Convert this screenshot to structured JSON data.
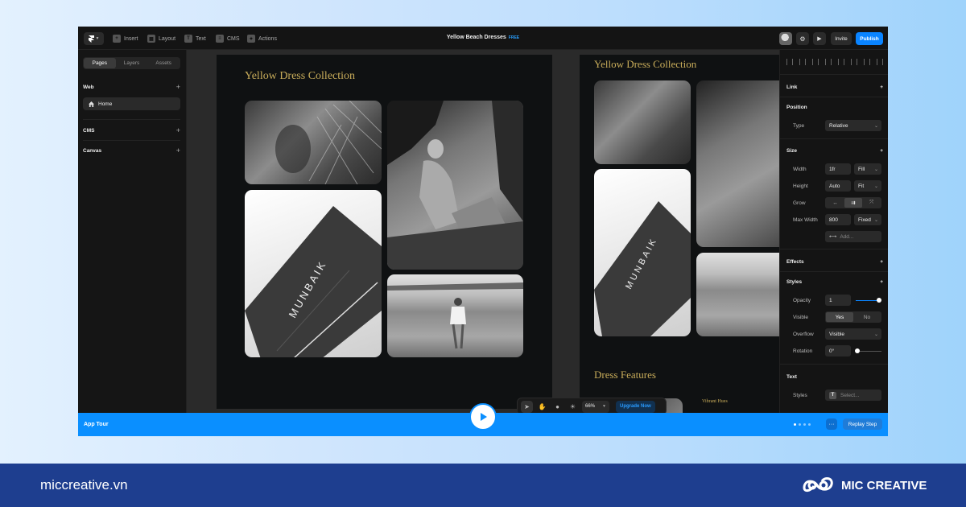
{
  "toolbar": {
    "insert": "Insert",
    "layout": "Layout",
    "text": "Text",
    "cms": "CMS",
    "actions": "Actions",
    "document_title": "Yellow Beach Dresses",
    "plan_badge": "FREE",
    "invite": "Invite",
    "publish": "Publish"
  },
  "left_panel": {
    "tabs": [
      "Pages",
      "Layers",
      "Assets"
    ],
    "active_tab": "Pages",
    "sections": {
      "web": "Web",
      "cms": "CMS",
      "canvas": "Canvas"
    },
    "pages": [
      "Home"
    ]
  },
  "canvas": {
    "frame_title": "Yellow Dress Collection",
    "frame2_title": "Yellow Dress Collection",
    "features_title": "Dress Features",
    "features_sub": "Vibrant Hues",
    "photo_text": "MUNBAIK",
    "zoom": "66%",
    "upgrade": "Upgrade Now"
  },
  "right_panel": {
    "sections": {
      "link": "Link",
      "position": "Position",
      "size": "Size",
      "effects": "Effects",
      "styles": "Styles",
      "text": "Text"
    },
    "type_label": "Type",
    "type_value": "Relative",
    "width_label": "Width",
    "width_value": "1fr",
    "width_mode": "Fill",
    "height_label": "Height",
    "height_value": "Auto",
    "height_mode": "Fit",
    "grow_label": "Grow",
    "max_width_label": "Max Width",
    "max_width_value": "800",
    "max_width_mode": "Fixed",
    "add_placeholder": "Add...",
    "opacity_label": "Opacity",
    "opacity_value": "1",
    "visible_label": "Visible",
    "visible_yes": "Yes",
    "visible_no": "No",
    "overflow_label": "Overflow",
    "overflow_value": "Visible",
    "rotation_label": "Rotation",
    "rotation_value": "0°",
    "text_styles_label": "Styles",
    "text_styles_placeholder": "Select..."
  },
  "tour": {
    "label": "App Tour",
    "replay": "Replay Step",
    "more": "···",
    "step_total": 4,
    "step_current": 1
  },
  "footer": {
    "url": "miccreative.vn",
    "brand": "MIC CREATIVE"
  },
  "colors": {
    "accent": "#0a84ff",
    "title_gold": "#c9ad5a",
    "footer_bg": "#1e3e8f"
  }
}
